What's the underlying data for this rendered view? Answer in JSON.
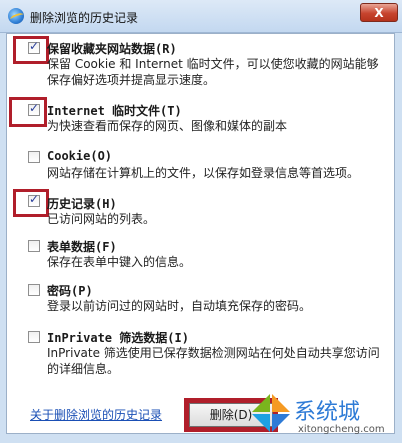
{
  "window": {
    "title": "删除浏览的历史记录",
    "close_label": "X"
  },
  "options": [
    {
      "title": "保留收藏夹网站数据(R)",
      "desc": "保留 Cookie 和 Internet 临时文件，可以使您收藏的网站能够保存偏好选项并提高显示速度。",
      "checked": true
    },
    {
      "title": "Internet 临时文件(T)",
      "desc": "为快速查看而保存的网页、图像和媒体的副本",
      "checked": true
    },
    {
      "title": "Cookie(O)",
      "desc": "网站存储在计算机上的文件，以保存如登录信息等首选项。",
      "checked": false
    },
    {
      "title": "历史记录(H)",
      "desc": "已访问网站的列表。",
      "checked": true
    },
    {
      "title": "表单数据(F)",
      "desc": "保存在表单中键入的信息。",
      "checked": false
    },
    {
      "title": "密码(P)",
      "desc": "登录以前访问过的网站时，自动填充保存的密码。",
      "checked": false
    },
    {
      "title": "InPrivate 筛选数据(I)",
      "desc": "InPrivate 筛选使用已保存数据检测网站在何处自动共享您访问的详细信息。",
      "checked": false
    }
  ],
  "footer": {
    "help_link": "关于删除浏览的历史记录",
    "delete_label": "删除(D)"
  },
  "watermark": {
    "text": "系统城",
    "url": "xitongcheng.com"
  }
}
